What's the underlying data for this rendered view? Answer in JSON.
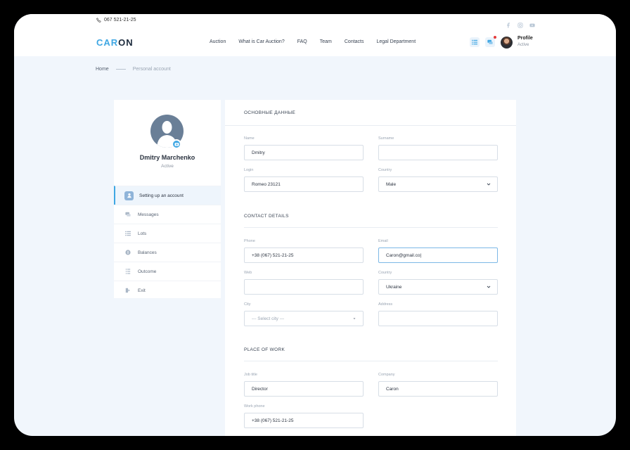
{
  "header": {
    "phone": "067 521-21-25",
    "logo_a": "CAR",
    "logo_b": "ON",
    "nav": [
      "Auction",
      "What is Car Auction?",
      "FAQ",
      "Team",
      "Contacts",
      "Legal Department"
    ],
    "profile_label": "Profile",
    "profile_status": "Active",
    "social_icons": [
      "facebook-icon",
      "instagram-icon",
      "youtube-icon"
    ]
  },
  "breadcrumb": {
    "home": "Home",
    "current": "Personal account"
  },
  "sidebar": {
    "name": "Dmitry Marchenko",
    "status": "Active",
    "items": [
      {
        "label": "Setting up an account",
        "icon": "user-icon",
        "active": true
      },
      {
        "label": "Messages",
        "icon": "messages-icon",
        "active": false
      },
      {
        "label": "Lots",
        "icon": "list-icon",
        "active": false
      },
      {
        "label": "Balances",
        "icon": "balance-icon",
        "active": false
      },
      {
        "label": "Outcome",
        "icon": "outcome-icon",
        "active": false
      },
      {
        "label": "Exit",
        "icon": "exit-icon",
        "active": false
      }
    ]
  },
  "form": {
    "basic_title": "ОСНОВНЫЕ ДАННЫЕ",
    "name_label": "Name",
    "name_value": "Dmitry",
    "surname_label": "Surname",
    "surname_value": "",
    "login_label": "Login",
    "login_value": "Romeo 23121",
    "country1_label": "Country",
    "country1_value": "Male",
    "contact_title": "CONTACT DETAILS",
    "phone_label": "Phone",
    "phone_value": "+38 (067) 521-21-25",
    "email_label": "Email",
    "email_value": "Caron@gmail.co|",
    "web_label": "Web",
    "web_value": "",
    "country2_label": "Country",
    "country2_value": "Ukraine",
    "city_label": "City",
    "city_placeholder": "--- Select city ---",
    "address_label": "Address",
    "address_value": "",
    "work_title": "PLACE OF WORK",
    "job_label": "Job title",
    "job_value": "Director",
    "company_label": "Company",
    "company_value": "Caron",
    "workphone_label": "Work phone",
    "workphone_value": "+38 (067) 521-21-25"
  },
  "colors": {
    "accent": "#3fa7e3",
    "background": "#f1f6fc",
    "notification": "#e53b3b"
  }
}
